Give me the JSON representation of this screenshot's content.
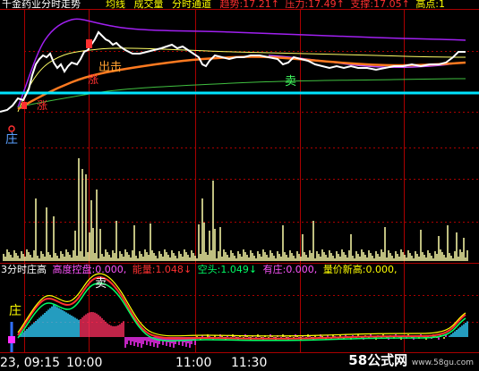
{
  "top_bar": {
    "title": "千金药业分时走势",
    "items": [
      {
        "label": "均线",
        "color": "#ffff00"
      },
      {
        "label": "成交量",
        "color": "#ffff00"
      },
      {
        "label": "分时通道",
        "color": "#ffff00"
      },
      {
        "label": "趋势:",
        "value": "17.21",
        "arrow": "↑",
        "color": "#ff3030"
      },
      {
        "label": "压力:",
        "value": "17.49",
        "arrow": "↑",
        "color": "#ff3030"
      },
      {
        "label": "支撑:",
        "value": "17.05",
        "arrow": "↑",
        "color": "#ff3030"
      },
      {
        "label": "高点:",
        "value": "1",
        "arrow": "",
        "color": "#ffff00"
      }
    ]
  },
  "price_annotations": {
    "out_label": "出击",
    "sell_label": "卖",
    "rise_label": "涨",
    "zhuang_label": "庄"
  },
  "indicator_bar": {
    "name": "3分时庄高",
    "items": [
      {
        "label": "高度控盘:",
        "value": "0.000,",
        "arrow": "",
        "color": "#ff55ff"
      },
      {
        "label": "能量:",
        "value": "1.048",
        "arrow": "↓",
        "color": "#ff3030"
      },
      {
        "label": "空头:",
        "value": "1.049",
        "arrow": "↓",
        "color": "#00ff66"
      },
      {
        "label": "有庄:",
        "value": "0.000,",
        "arrow": "",
        "color": "#ff55ff"
      },
      {
        "label": "量价新高:",
        "value": "0.000,",
        "arrow": "",
        "color": "#ffff00"
      }
    ],
    "sell_label": "卖",
    "zhuang_label": "庄"
  },
  "time_axis": [
    "23, 09:15",
    "10:00",
    "11:00",
    "11:30"
  ],
  "watermark": "58公式网",
  "watermark_sub": "www.58gu.com",
  "colors": {
    "background": "#000000",
    "frame": "#aa0000",
    "price_line": "#ffffff",
    "avg_line": "#ff8000",
    "channel_top": "#a020f0",
    "channel_yellow": "#ffff66",
    "support_green": "#40c040",
    "cyan_line": "#00e5ff",
    "volume": "#ffffaa"
  }
}
